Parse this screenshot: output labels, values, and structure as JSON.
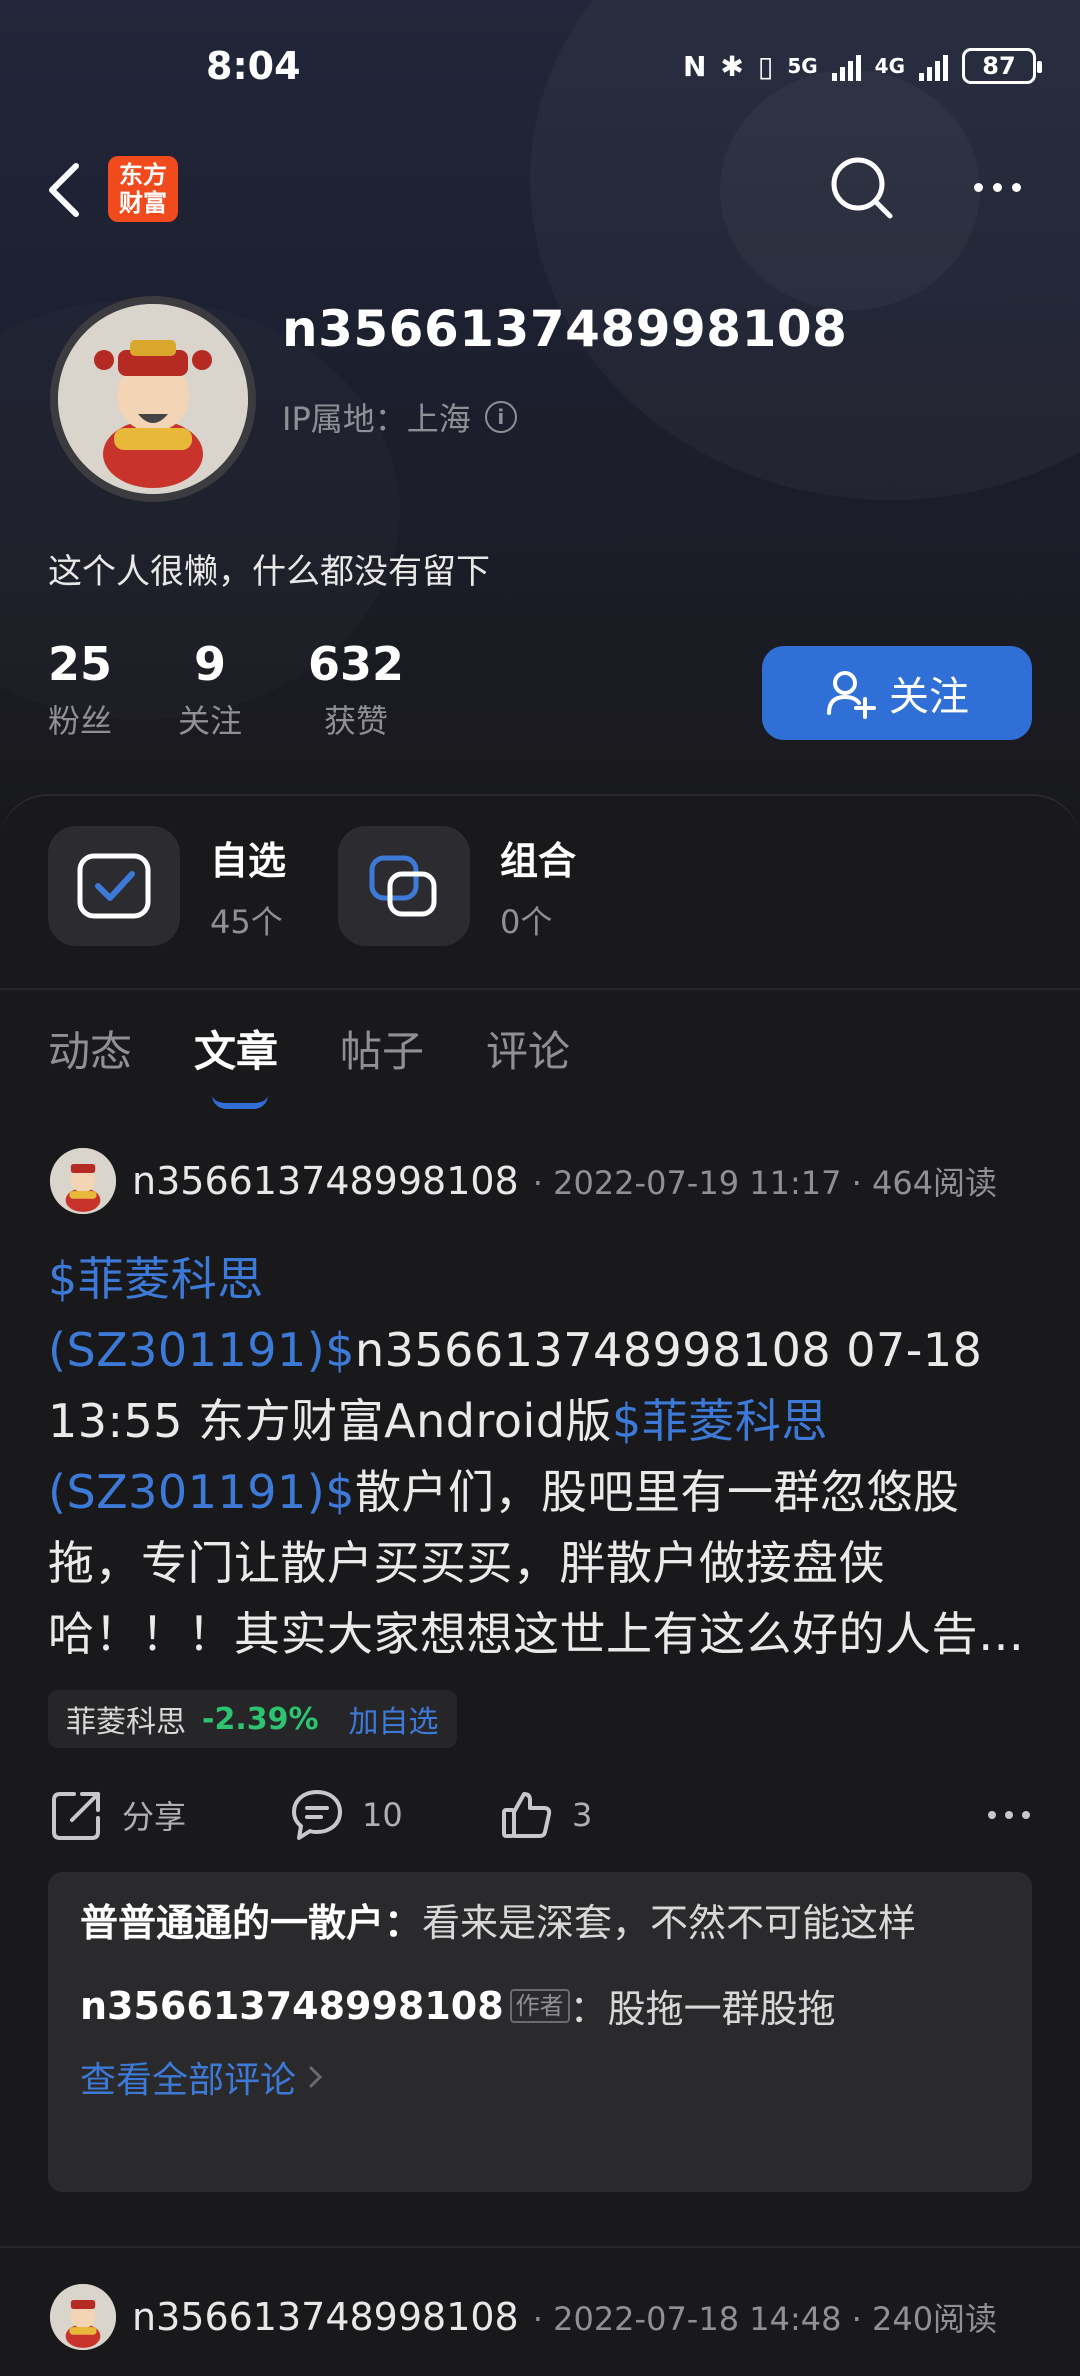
{
  "status_bar": {
    "time": "8:04",
    "nfc": "N",
    "bluetooth": "✱",
    "vibrate": "▯",
    "net5g": "5G",
    "net4g": "4G",
    "battery": "87"
  },
  "header": {
    "logo_line1": "东方",
    "logo_line2": "财富"
  },
  "profile": {
    "username": "n356613748998108",
    "ip_location": "IP属地：上海",
    "bio": "这个人很懒，什么都没有留下",
    "stats": [
      {
        "value": "25",
        "label": "粉丝"
      },
      {
        "value": "9",
        "label": "关注"
      },
      {
        "value": "632",
        "label": "获赞"
      }
    ],
    "follow_label": "关注"
  },
  "quick_cards": [
    {
      "title": "自选",
      "sub": "45个"
    },
    {
      "title": "组合",
      "sub": "0个"
    }
  ],
  "tabs": [
    "动态",
    "文章",
    "帖子",
    "评论"
  ],
  "active_tab": "文章",
  "posts": [
    {
      "author": "n356613748998108",
      "meta": "· 2022-07-19 11:17 · 464阅读",
      "stock_prefix": "$菲菱科思(SZ301191)$",
      "text_part1": "n356613748998108 07-18 13:55 东方财富Android版",
      "stock_link2": "$菲菱科思(SZ301191)$",
      "text_part2": "散户们，股吧里有一群忽悠股拖，专门让散户买买买，胖散户做接盘侠哈！！！其实大家想想这世上有这么好的人告诉你来赚钱麽？？？这群股拖好意思的人...",
      "tag_name": "菲菱科思",
      "tag_change": "-2.39%",
      "tag_add": "加自选",
      "share_label": "分享",
      "comment_count": "10",
      "like_count": "3",
      "comment1_author": "普普通通的一散户：",
      "comment1_text": "看来是深套，不然不可能这样",
      "comment2_author": "n356613748998108",
      "comment2_badge": "作者",
      "comment2_text": "：股拖一群股拖",
      "view_all": "查看全部评论"
    },
    {
      "author": "n356613748998108",
      "meta": "· 2022-07-18 14:48 · 240阅读"
    }
  ],
  "colors": {
    "accent": "#2f6fd6",
    "link": "#3d7ad8",
    "down": "#2ec46f",
    "logo": "#f04a1d"
  }
}
